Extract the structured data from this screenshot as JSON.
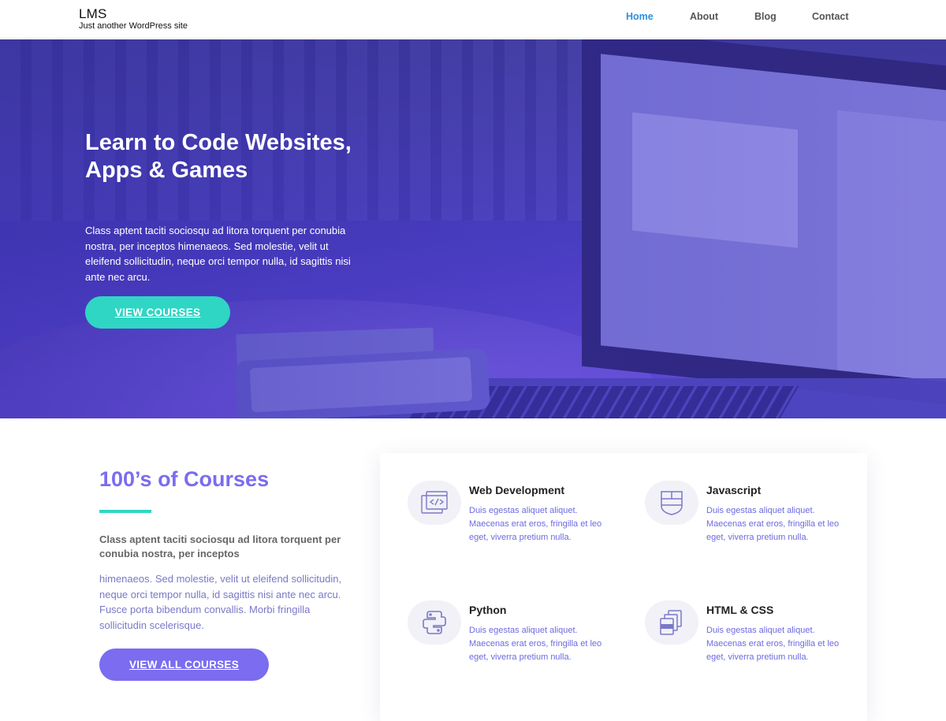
{
  "header": {
    "site_title": "LMS",
    "site_tagline": "Just another WordPress site",
    "nav": [
      {
        "label": "Home",
        "active": true
      },
      {
        "label": "About",
        "active": false
      },
      {
        "label": "Blog",
        "active": false
      },
      {
        "label": "Contact",
        "active": false
      }
    ]
  },
  "hero": {
    "title": "Learn to Code Websites, Apps & Games",
    "text": "Class aptent taciti sociosqu ad litora torquent per conubia nostra, per inceptos himenaeos. Sed molestie, velit ut eleifend sollicitudin, neque orci tempor nulla, id sagittis nisi ante nec arcu.",
    "button": "VIEW COURSES"
  },
  "courses": {
    "title": "100’s of Courses",
    "lead": "Class aptent taciti sociosqu ad litora torquent per conubia nostra, per inceptos",
    "body": "himenaeos. Sed molestie, velit ut eleifend sollicitudin, neque orci tempor nulla, id sagittis nisi ante nec arcu. Fusce porta bibendum convallis. Morbi fringilla sollicitudin scelerisque.",
    "button": "VIEW ALL COURSES",
    "features": [
      {
        "title": "Web Development",
        "icon": "code-window-icon",
        "text": "Duis egestas aliquet aliquet. Maecenas erat eros, fringilla et leo eget, viverra pretium nulla."
      },
      {
        "title": "Javascript",
        "icon": "shield-layout-icon",
        "text": "Duis egestas aliquet aliquet. Maecenas erat eros, fringilla et leo eget, viverra pretium nulla."
      },
      {
        "title": "Python",
        "icon": "python-icon",
        "text": "Duis egestas aliquet aliquet. Maecenas erat eros, fringilla et leo eget, viverra pretium nulla."
      },
      {
        "title": "HTML & CSS",
        "icon": "files-icon",
        "text": "Duis egestas aliquet aliquet. Maecenas erat eros, fringilla et leo eget, viverra pretium nulla."
      }
    ]
  },
  "colors": {
    "accent_teal": "#2fd6c4",
    "accent_purple": "#7b6cf0",
    "nav_active": "#2e8fde"
  }
}
